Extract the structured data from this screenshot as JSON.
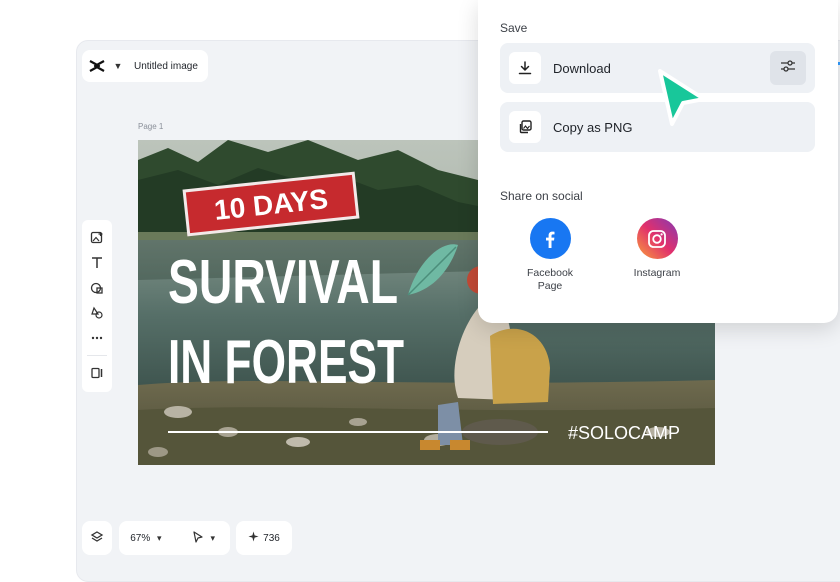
{
  "app": {
    "title": "Untitled image",
    "page_label": "Page 1"
  },
  "canvas": {
    "badge_text": "10 DAYS",
    "headline_line1": "SURVIVAL",
    "headline_line2": "IN FOREST",
    "hashtag": "#SOLOCAMP"
  },
  "toolbar": {
    "tools": [
      "image-add-icon",
      "text-icon",
      "shapes-icon",
      "elements-icon",
      "more-icon",
      "panel-toggle-icon"
    ]
  },
  "bottom_bar": {
    "zoom": "67%",
    "credits": "736"
  },
  "save_panel": {
    "heading": "Save",
    "download_label": "Download",
    "copy_label": "Copy as PNG",
    "share_heading": "Share on social",
    "socials": [
      {
        "line1": "Facebook",
        "line2": "Page",
        "icon": "facebook-icon",
        "color": "#1877f2"
      },
      {
        "line1": "Instagram",
        "line2": "",
        "icon": "instagram-icon",
        "color": "#e1306c"
      }
    ]
  },
  "colors": {
    "accent": "#18c79a",
    "badge_red": "#c62a2e",
    "panel_row": "#eef1f5"
  }
}
